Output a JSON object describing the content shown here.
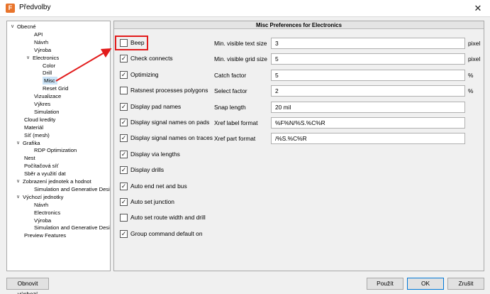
{
  "window": {
    "title": "Předvolby",
    "app_icon_glyph": "F",
    "app_icon_name": "fusion-app-icon",
    "close_glyph": "✕"
  },
  "tree": {
    "items": [
      {
        "label": "Obecné",
        "twisty": "∨",
        "selected": false
      },
      {
        "label": "API",
        "selected": false
      },
      {
        "label": "Návrh",
        "selected": false
      },
      {
        "label": "Výroba",
        "selected": false
      },
      {
        "label": "Electronics",
        "twisty": "∨",
        "selected": false
      },
      {
        "label": "Color",
        "selected": false
      },
      {
        "label": "Drill",
        "selected": false
      },
      {
        "label": "Misc",
        "selected": true
      },
      {
        "label": "Reset Grid",
        "selected": false
      },
      {
        "label": "Vizualizace",
        "selected": false
      },
      {
        "label": "Výkres",
        "selected": false
      },
      {
        "label": "Simulation",
        "selected": false
      },
      {
        "label": "Cloud kredity",
        "selected": false
      },
      {
        "label": "Materiál",
        "selected": false
      },
      {
        "label": "Síť (mesh)",
        "selected": false
      },
      {
        "label": "Grafika",
        "twisty": "∨",
        "selected": false
      },
      {
        "label": "RDP Optimization",
        "selected": false
      },
      {
        "label": "Nest",
        "selected": false
      },
      {
        "label": "Počítačová síť",
        "selected": false
      },
      {
        "label": "Sběr a využití dat",
        "selected": false
      },
      {
        "label": "Zobrazení jednotek a hodnot",
        "twisty": "∨",
        "selected": false
      },
      {
        "label": "Simulation and Generative Design",
        "selected": false
      },
      {
        "label": "Výchozí jednotky",
        "twisty": "∨",
        "selected": false
      },
      {
        "label": "Návrh",
        "selected": false
      },
      {
        "label": "Electronics",
        "selected": false
      },
      {
        "label": "Výroba",
        "selected": false
      },
      {
        "label": "Simulation and Generative Design",
        "selected": false
      },
      {
        "label": "Preview Features",
        "selected": false
      }
    ]
  },
  "panel": {
    "header": "Misc Preferences for Electronics",
    "checkboxes": [
      {
        "label": "Beep",
        "checked": false
      },
      {
        "label": "Check connects",
        "checked": true
      },
      {
        "label": "Optimizing",
        "checked": true
      },
      {
        "label": "Ratsnest processes polygons",
        "checked": false
      },
      {
        "label": "Display pad names",
        "checked": true
      },
      {
        "label": "Display signal names on pads",
        "checked": true
      },
      {
        "label": "Display signal names on traces",
        "checked": true
      },
      {
        "label": "Display via lengths",
        "checked": true
      },
      {
        "label": "Display drills",
        "checked": true
      },
      {
        "label": "Auto end net and bus",
        "checked": true
      },
      {
        "label": "Auto set junction",
        "checked": true
      },
      {
        "label": "Auto set route width and drill",
        "checked": false
      },
      {
        "label": "Group command default on",
        "checked": true
      }
    ],
    "fields": [
      {
        "label": "Min. visible text size",
        "value": "3",
        "unit": "pixel"
      },
      {
        "label": "Min. visible grid size",
        "value": "5",
        "unit": "pixel"
      },
      {
        "label": "Catch factor",
        "value": "5",
        "unit": "%"
      },
      {
        "label": "Select factor",
        "value": "2",
        "unit": "%"
      },
      {
        "label": "Snap length",
        "value": "20 mil",
        "unit": ""
      },
      {
        "label": "Xref label format",
        "value": "%F%N/%S.%C%R",
        "unit": ""
      },
      {
        "label": "Xref part format",
        "value": "/%S.%C%R",
        "unit": ""
      }
    ],
    "check_glyph": "✓"
  },
  "buttons": {
    "reset": "Obnovit výchozí",
    "apply": "Použít",
    "ok": "OK",
    "cancel": "Zrušit"
  },
  "annotation": {
    "color": "#e21b1b"
  }
}
